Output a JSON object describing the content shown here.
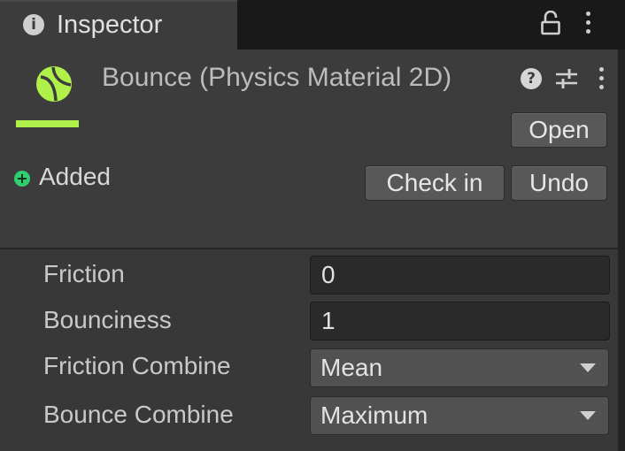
{
  "tab": {
    "title": "Inspector",
    "info_icon": "i"
  },
  "header": {
    "title": "Bounce (Physics Material 2D)",
    "help_icon": "?",
    "accent": "#b0f04a",
    "open_label": "Open",
    "status": {
      "label": "Added",
      "icon": "+",
      "color": "#2fcf6f"
    },
    "checkin_label": "Check in",
    "undo_label": "Undo"
  },
  "properties": [
    {
      "label": "Friction",
      "value": "0",
      "kind": "number"
    },
    {
      "label": "Bounciness",
      "value": "1",
      "kind": "number"
    },
    {
      "label": "Friction Combine",
      "value": "Mean",
      "kind": "dropdown"
    },
    {
      "label": "Bounce Combine",
      "value": "Maximum",
      "kind": "dropdown"
    }
  ]
}
